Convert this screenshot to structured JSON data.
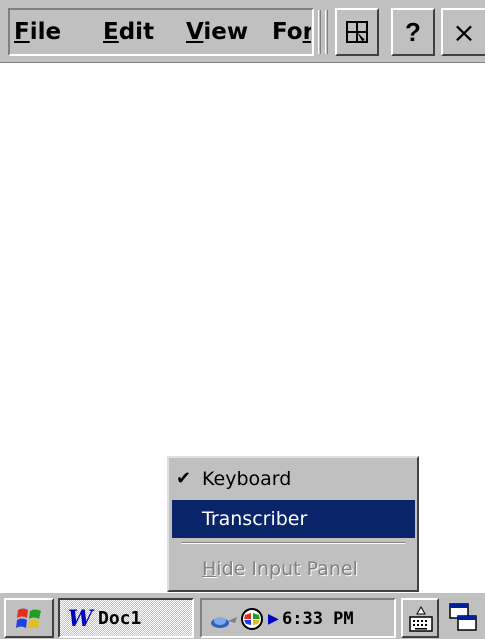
{
  "menubar": {
    "file_label": "File",
    "edit_label": "Edit",
    "view_label": "View",
    "format_label": "Format",
    "help_label": "?",
    "close_label": "×",
    "ink_icon": "ink-pen-icon"
  },
  "popup": {
    "keyboard_check": "✔",
    "keyboard_label": "Keyboard",
    "transcriber_label": "Transcriber",
    "hide_label": "Hide Input Panel"
  },
  "taskbar": {
    "start_icon": "windows-flag-icon",
    "task_label": "Doc1",
    "task_icon_glyph": "W",
    "clock": "6:33 PM",
    "tray_arrow": "▶",
    "sip_icon": "keyboard-icon",
    "desktop_icon": "show-desktop-icon"
  },
  "colors": {
    "face": "#c0c0c0",
    "highlight": "#0a246a",
    "disabled_text": "#808080"
  }
}
